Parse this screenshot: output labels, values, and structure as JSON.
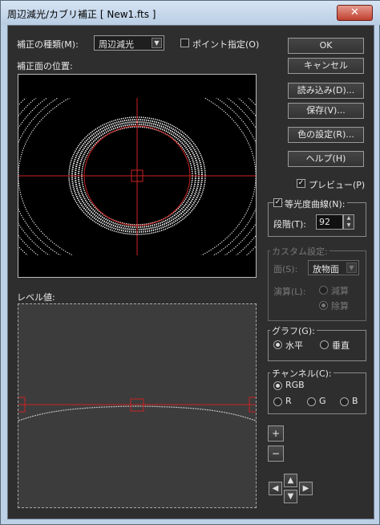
{
  "window": {
    "title": "周辺減光/カブリ補正 [ New1.fts ]",
    "close_label": "✕"
  },
  "correction_type": {
    "label": "補正の種類(M):",
    "value": "周辺減光"
  },
  "point_spec": {
    "label": "ポイント指定(O)",
    "checked": false
  },
  "surface_position_label": "補正面の位置:",
  "level_label": "レベル値:",
  "buttons": {
    "ok": "OK",
    "cancel": "キャンセル",
    "load": "読み込み(D)...",
    "save": "保存(V)...",
    "color_settings": "色の設定(R)...",
    "help": "ヘルプ(H)"
  },
  "preview": {
    "label": "プレビュー(P)",
    "checked": true
  },
  "isophote": {
    "label": "等光度曲線(N):",
    "checked": true,
    "steps_label": "段階(T):",
    "steps_value": "92"
  },
  "custom_settings": {
    "title": "カスタム設定:",
    "surface_label": "面(S):",
    "surface_value": "放物面",
    "operation_label": "演算(L):",
    "options": [
      "減算",
      "除算"
    ],
    "selected": "除算"
  },
  "graph": {
    "title": "グラフ(G):",
    "options": [
      "水平",
      "垂直"
    ],
    "selected": "水平"
  },
  "channel": {
    "title": "チャンネル(C):",
    "options": [
      "RGB",
      "R",
      "G",
      "B"
    ],
    "selected": "RGB"
  },
  "zoom": {
    "plus": "+",
    "minus": "−"
  },
  "nav_icons": [
    "arrow-up-icon",
    "arrow-down-icon",
    "arrow-left-icon",
    "arrow-right-icon"
  ],
  "colors": {
    "crosshair": "#cc2222",
    "accent_title": "#bcd0e6"
  }
}
